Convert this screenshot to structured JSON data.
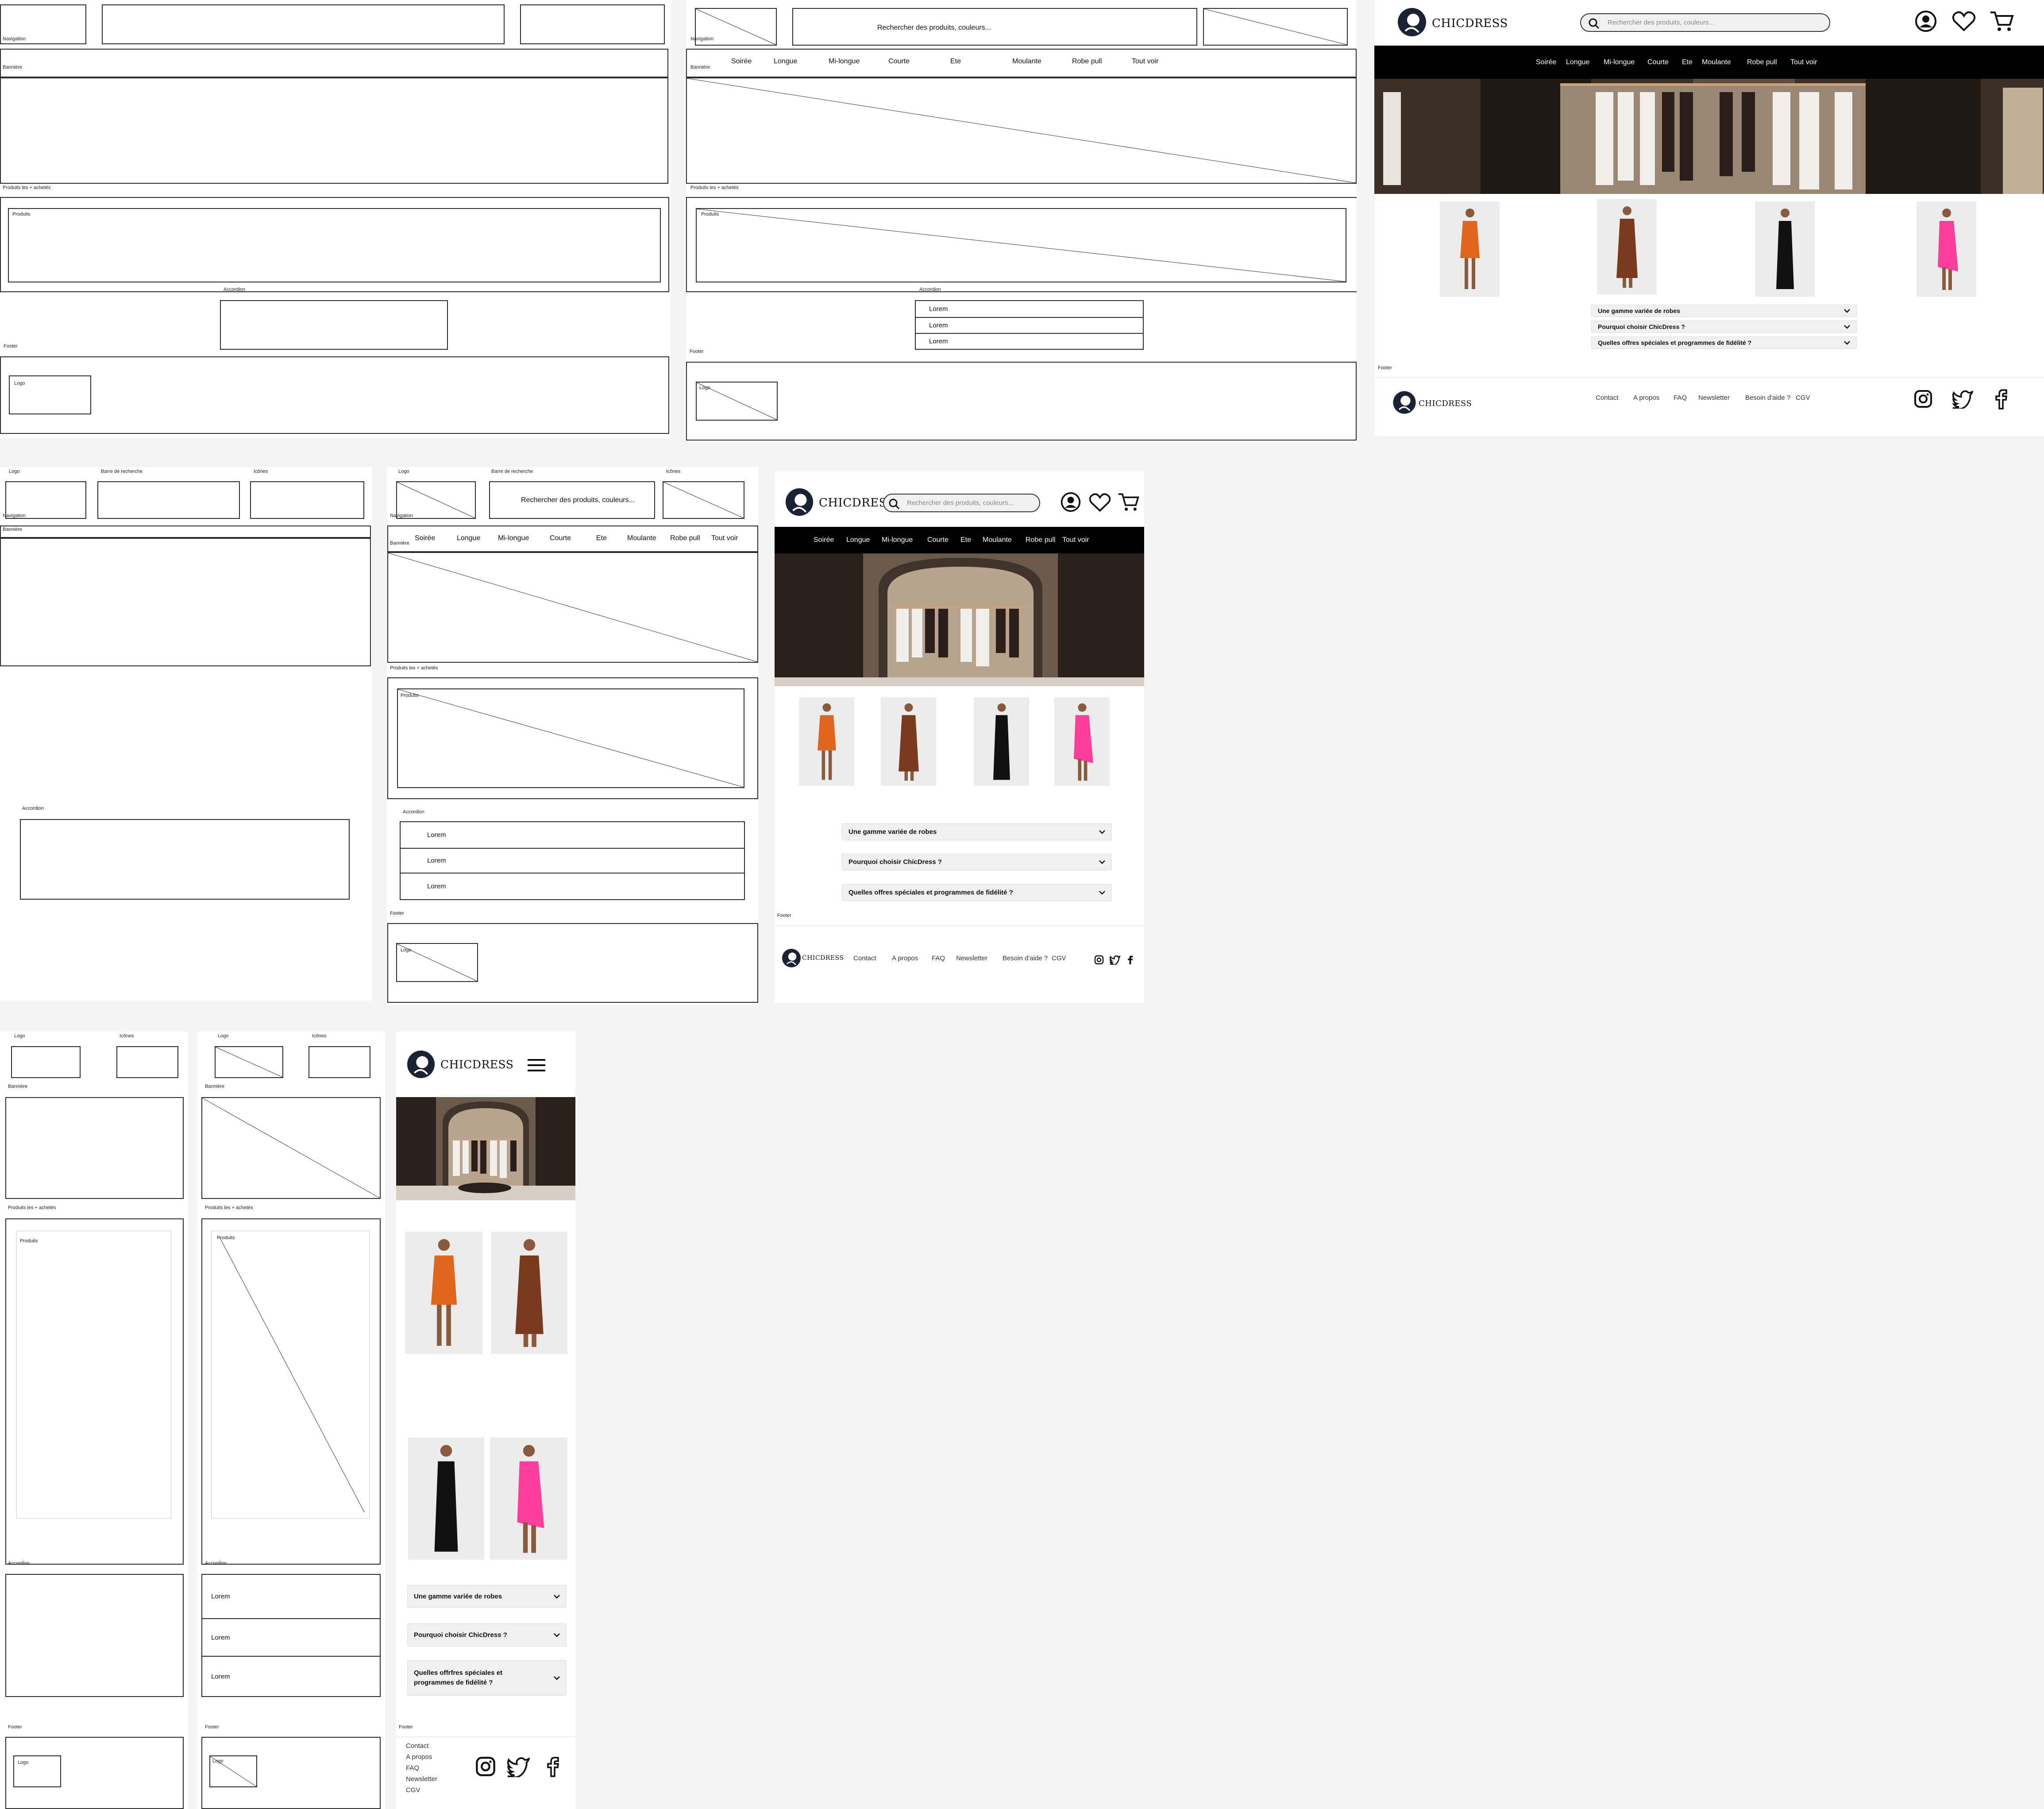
{
  "labels": {
    "logo": "Logo",
    "search_bar": "Barre de recherche",
    "icons": "Icônes",
    "navigation": "Navigation",
    "banner": "Bannière",
    "top_products": "Produits les + achetés",
    "top_products_alt": "Produits les + achetés",
    "products": "Produits",
    "accordion": "Accordion",
    "footer": "Footer"
  },
  "search_placeholder_wire": "Rechercher des produits, couleurs...",
  "search_placeholder": "Rechercher des produits, couleurs...",
  "brand": "CHICDRESS",
  "nav": [
    "Soirée",
    "Longue",
    "Mi-longue",
    "Courte",
    "Ete",
    "Moulante",
    "Robe pull",
    "Tout voir"
  ],
  "lorem": "Lorem",
  "faq": [
    "Une gamme variée de robes",
    "Pourquoi choisir ChicDress ?",
    "Quelles offres spéciales et programmes de fidélité ?"
  ],
  "faq_mobile": [
    "Une gamme variée de robes",
    "Pourquoi choisir ChicDress ?",
    "Quelles offrfres spéciales et programmes de fidélité ?"
  ],
  "footer_links": [
    "Contact",
    "A propos",
    "FAQ",
    "Newsletter",
    "Besoin d'aide ?",
    "CGV"
  ],
  "colors": {
    "orange_dress": "#e0661e",
    "brown_dress": "#7a3a1e",
    "black_dress": "#111111",
    "pink_dress": "#ff3d9a",
    "skin": "#8a5a3c"
  },
  "icons": [
    "user-icon",
    "heart-icon",
    "cart-icon",
    "search-icon",
    "instagram-icon",
    "twitter-icon",
    "facebook-icon",
    "hamburger-icon",
    "chevron-down-icon"
  ]
}
